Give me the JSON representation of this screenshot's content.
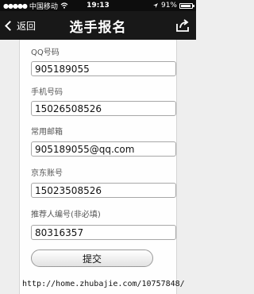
{
  "status_bar": {
    "signal": "●●●●●",
    "carrier": "中国移动",
    "wifi_icon": "wifi-icon",
    "time": "19:13",
    "battery_percent": "91%",
    "battery_level": 0.91
  },
  "nav": {
    "back_label": "返回",
    "title": "选手报名",
    "share_icon": "share-icon"
  },
  "form": {
    "fields": [
      {
        "label": "QQ号码",
        "value": "905189055"
      },
      {
        "label": "手机号码",
        "value": "15026508526"
      },
      {
        "label": "常用邮箱",
        "value": "905189055@qq.com"
      },
      {
        "label": "京东账号",
        "value": "15023508526"
      },
      {
        "label": "推荐人编号(非必填)",
        "value": "80316357"
      }
    ],
    "submit_label": "提交"
  },
  "watermark": "http://home.zhubajie.com/10757848/"
}
